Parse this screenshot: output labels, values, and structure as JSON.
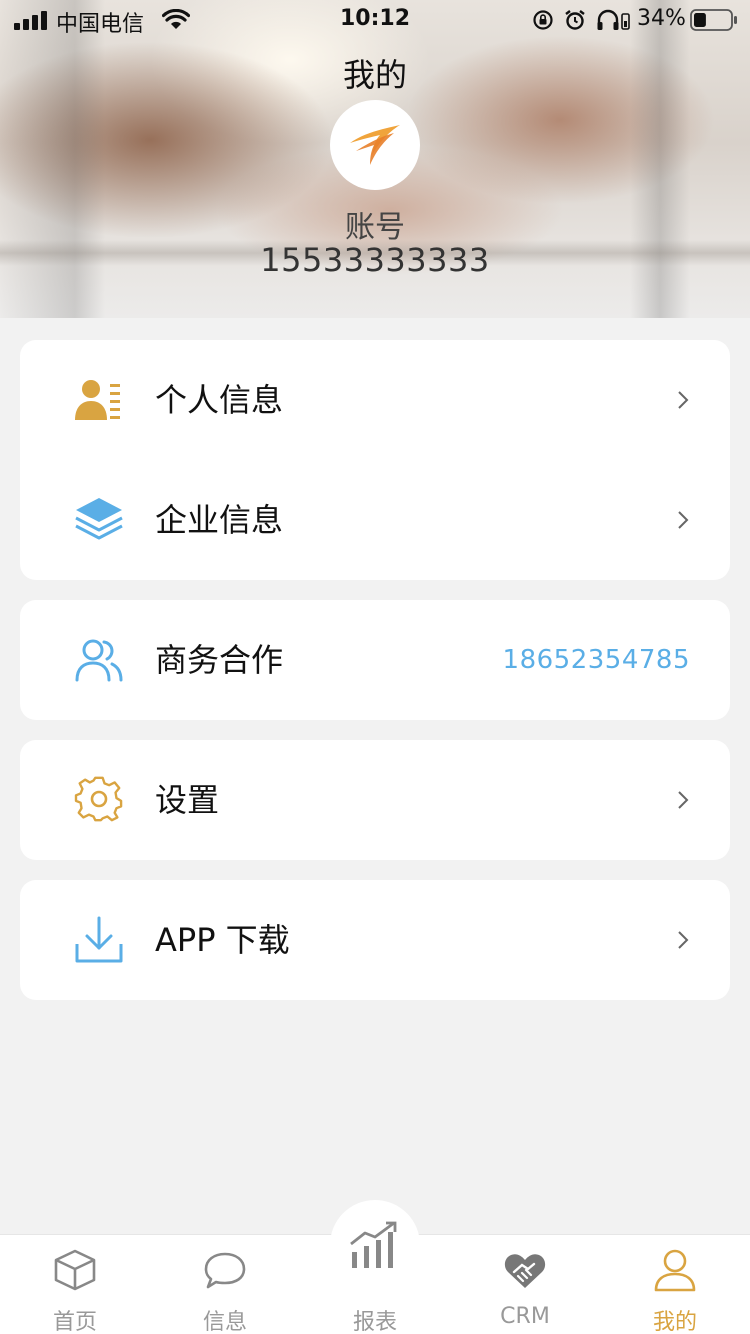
{
  "status_bar": {
    "carrier": "中国电信",
    "time": "10:12",
    "battery_percent": "34%",
    "battery_level": 0.34
  },
  "header": {
    "title": "我的",
    "account_label": "账号",
    "account_number": "15533333333"
  },
  "menu": {
    "personal_info": {
      "label": "个人信息",
      "icon": "user-card-icon"
    },
    "company_info": {
      "label": "企业信息",
      "icon": "layers-icon"
    },
    "business": {
      "label": "商务合作",
      "icon": "people-icon",
      "phone": "18652354785"
    },
    "settings": {
      "label": "设置",
      "icon": "gear-icon"
    },
    "app_download": {
      "label": "APP 下载",
      "icon": "download-icon"
    }
  },
  "tabs": [
    {
      "label": "首页",
      "icon": "cube-icon",
      "active": false
    },
    {
      "label": "信息",
      "icon": "chat-bubble-icon",
      "active": false
    },
    {
      "label": "报表",
      "icon": "bar-chart-icon",
      "active": false
    },
    {
      "label": "CRM",
      "icon": "handshake-icon",
      "active": false
    },
    {
      "label": "我的",
      "icon": "user-icon",
      "active": true
    }
  ],
  "colors": {
    "accent": "#d9a441",
    "blue": "#5aaee6",
    "inactive_tab": "#999999",
    "background": "#f2f2f2"
  }
}
